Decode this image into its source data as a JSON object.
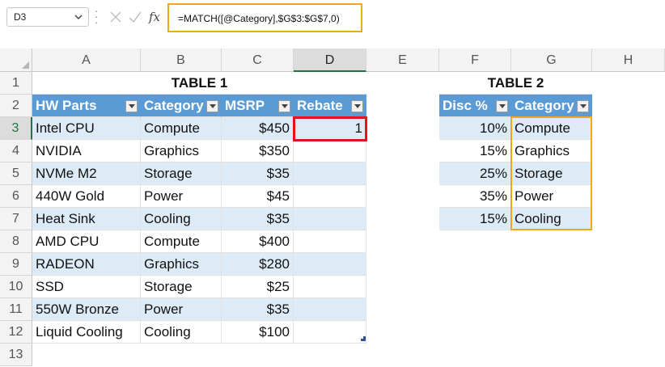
{
  "formula_bar": {
    "name_box": "D3",
    "formula": "=MATCH([@Category],$G$3:$G$7,0)",
    "fx_label": "fx"
  },
  "colors": {
    "table_header": "#5b9bd5",
    "band": "#ddebf7",
    "active_cell_border": "#e0141e",
    "highlight_border": "#f0a818"
  },
  "columns": [
    "A",
    "B",
    "C",
    "D",
    "E",
    "F",
    "G",
    "H"
  ],
  "rows": [
    "1",
    "2",
    "3",
    "4",
    "5",
    "6",
    "7",
    "8",
    "9",
    "10",
    "11",
    "12",
    "13"
  ],
  "table1": {
    "title": "TABLE 1",
    "headers": [
      "HW Parts",
      "Category",
      "MSRP",
      "Rebate"
    ],
    "rows": [
      [
        "Intel CPU",
        "Compute",
        "$450",
        "1"
      ],
      [
        "NVIDIA",
        "Graphics",
        "$350",
        ""
      ],
      [
        "NVMe M2",
        "Storage",
        "$35",
        ""
      ],
      [
        "440W Gold",
        "Power",
        "$45",
        ""
      ],
      [
        "Heat Sink",
        "Cooling",
        "$35",
        ""
      ],
      [
        "AMD CPU",
        "Compute",
        "$400",
        ""
      ],
      [
        "RADEON",
        "Graphics",
        "$280",
        ""
      ],
      [
        "SSD",
        "Storage",
        "$25",
        ""
      ],
      [
        "550W Bronze",
        "Power",
        "$35",
        ""
      ],
      [
        "Liquid Cooling",
        "Cooling",
        "$100",
        ""
      ]
    ]
  },
  "table2": {
    "title": "TABLE 2",
    "headers": [
      "Disc %",
      "Category"
    ],
    "rows": [
      [
        "10%",
        "Compute"
      ],
      [
        "15%",
        "Graphics"
      ],
      [
        "25%",
        "Storage"
      ],
      [
        "35%",
        "Power"
      ],
      [
        "15%",
        "Cooling"
      ]
    ]
  }
}
